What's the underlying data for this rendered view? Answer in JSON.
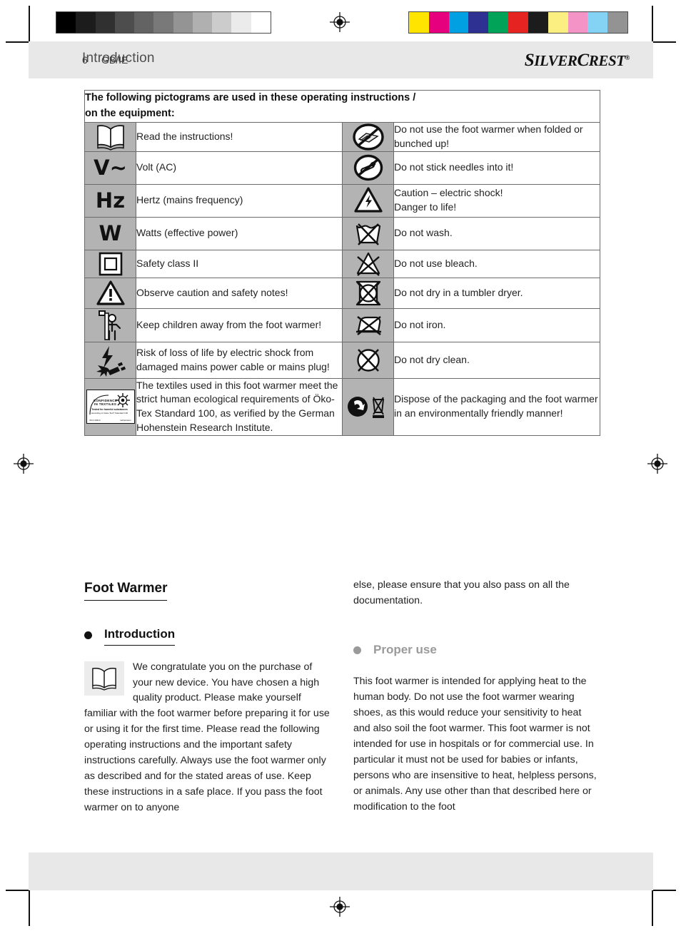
{
  "header": {
    "title": "Introduction"
  },
  "footer": {
    "page_number": "6",
    "language": "GB/IE",
    "brand_first": "S",
    "brand_part1": "ILVER",
    "brand_c": "C",
    "brand_part2": "REST",
    "brand_reg": "®"
  },
  "colorbars": {
    "grayscale": [
      "#000000",
      "#1c1c1c",
      "#303030",
      "#4d4d4d",
      "#636363",
      "#797979",
      "#949494",
      "#b0b0b0",
      "#cccccc",
      "#ebebeb",
      "#ffffff"
    ],
    "process": [
      "#ffe400",
      "#e6007e",
      "#00a0e3",
      "#2e3192",
      "#00a358",
      "#e52421",
      "#1c1c1c",
      "#fbef81",
      "#f493c5",
      "#85d3f4",
      "#939393"
    ]
  },
  "table": {
    "heading_line1": "The following pictograms are used in these operating instructions /",
    "heading_line2": "on the equipment:",
    "rows": [
      {
        "left": {
          "icon": "open-book-icon",
          "symbol": "",
          "text": "Read the instructions!"
        },
        "right": {
          "icon": "no-folded-warmer-icon",
          "symbol": "",
          "text": "Do not use the foot warmer when folded or bunched up!"
        }
      },
      {
        "left": {
          "icon": "volt-ac-symbol",
          "symbol": "V~",
          "text": "Volt (AC)"
        },
        "right": {
          "icon": "no-needles-icon",
          "symbol": "",
          "text": "Do not stick needles into it!"
        }
      },
      {
        "left": {
          "icon": "hertz-symbol",
          "symbol": "Hz",
          "text": "Hertz (mains frequency)"
        },
        "right": {
          "icon": "electric-shock-warning-icon",
          "symbol": "",
          "text": "Caution –  electric shock!\nDanger to life!"
        }
      },
      {
        "left": {
          "icon": "watts-symbol",
          "symbol": "W",
          "text": "Watts (effective power)"
        },
        "right": {
          "icon": "do-not-wash-icon",
          "symbol": "",
          "text": "Do not wash."
        }
      },
      {
        "left": {
          "icon": "safety-class-two-icon",
          "symbol": "",
          "text": "Safety class II"
        },
        "right": {
          "icon": "do-not-bleach-icon",
          "symbol": "",
          "text": "Do not use bleach."
        }
      },
      {
        "left": {
          "icon": "caution-triangle-icon",
          "symbol": "",
          "text": "Observe caution and safety notes!"
        },
        "right": {
          "icon": "do-not-tumble-dry-icon",
          "symbol": "",
          "text": "Do not dry in a tumbler dryer."
        }
      },
      {
        "left": {
          "icon": "keep-children-away-icon",
          "symbol": "",
          "text": "Keep children away from the foot warmer!"
        },
        "right": {
          "icon": "do-not-iron-icon",
          "symbol": "",
          "text": "Do not iron."
        }
      },
      {
        "left": {
          "icon": "damaged-plug-shock-icon",
          "symbol": "",
          "text": "Risk of loss of life by electric shock from damaged mains power cable or mains plug!"
        },
        "right": {
          "icon": "do-not-dry-clean-icon",
          "symbol": "",
          "text": "Do not dry clean."
        }
      },
      {
        "left": {
          "icon": "oeko-tex-confidence-in-textiles-icon",
          "symbol": "",
          "text": "The textiles used in this foot warmer meet the strict human ecological requirements of Öko-Tex Standard 100, as verified by the German Hohenstein Research Institute."
        },
        "right": {
          "icon": "recycle-and-wee-bin-icon",
          "symbol": "",
          "text": "Dispose of the packaging and the foot warmer in an environmentally friendly manner!"
        }
      }
    ],
    "oeko_logo": {
      "line1": "CONFIDENCE",
      "line2": "IN TEXTILES",
      "line3": "Tested for harmful substances",
      "line4": "according to Oeko-Tex® Standard 100",
      "line5": "06.0.40314",
      "line6": "Hohenstein"
    }
  },
  "content": {
    "product_title": "Foot Warmer",
    "left_section_heading": "Introduction",
    "left_paragraph": "We congratulate you on the purchase of your new device. You have chosen a high quality product. Please make yourself familiar with the foot warmer before preparing it for use or using it for the first time. Please read the following operating instructions and the important safety instructions carefully. Always use the foot warmer only as described and for the stated areas of use. Keep these instructions in a safe place. If you pass the foot warmer on to anyone",
    "right_continuation": "else, please ensure that you also pass on all the documentation.",
    "right_section_heading": "Proper use",
    "right_paragraph": "This foot warmer is intended for applying heat to the human body. Do not use the foot warmer wearing shoes, as this would reduce your sensitivity to heat and also soil the foot warmer. This foot warmer is not intended for use in hospitals or for commercial use. In particular it must not be used for babies or infants, persons who are insensitive to heat, helpless persons, or animals. Any use other than that described here or modification to the foot"
  }
}
